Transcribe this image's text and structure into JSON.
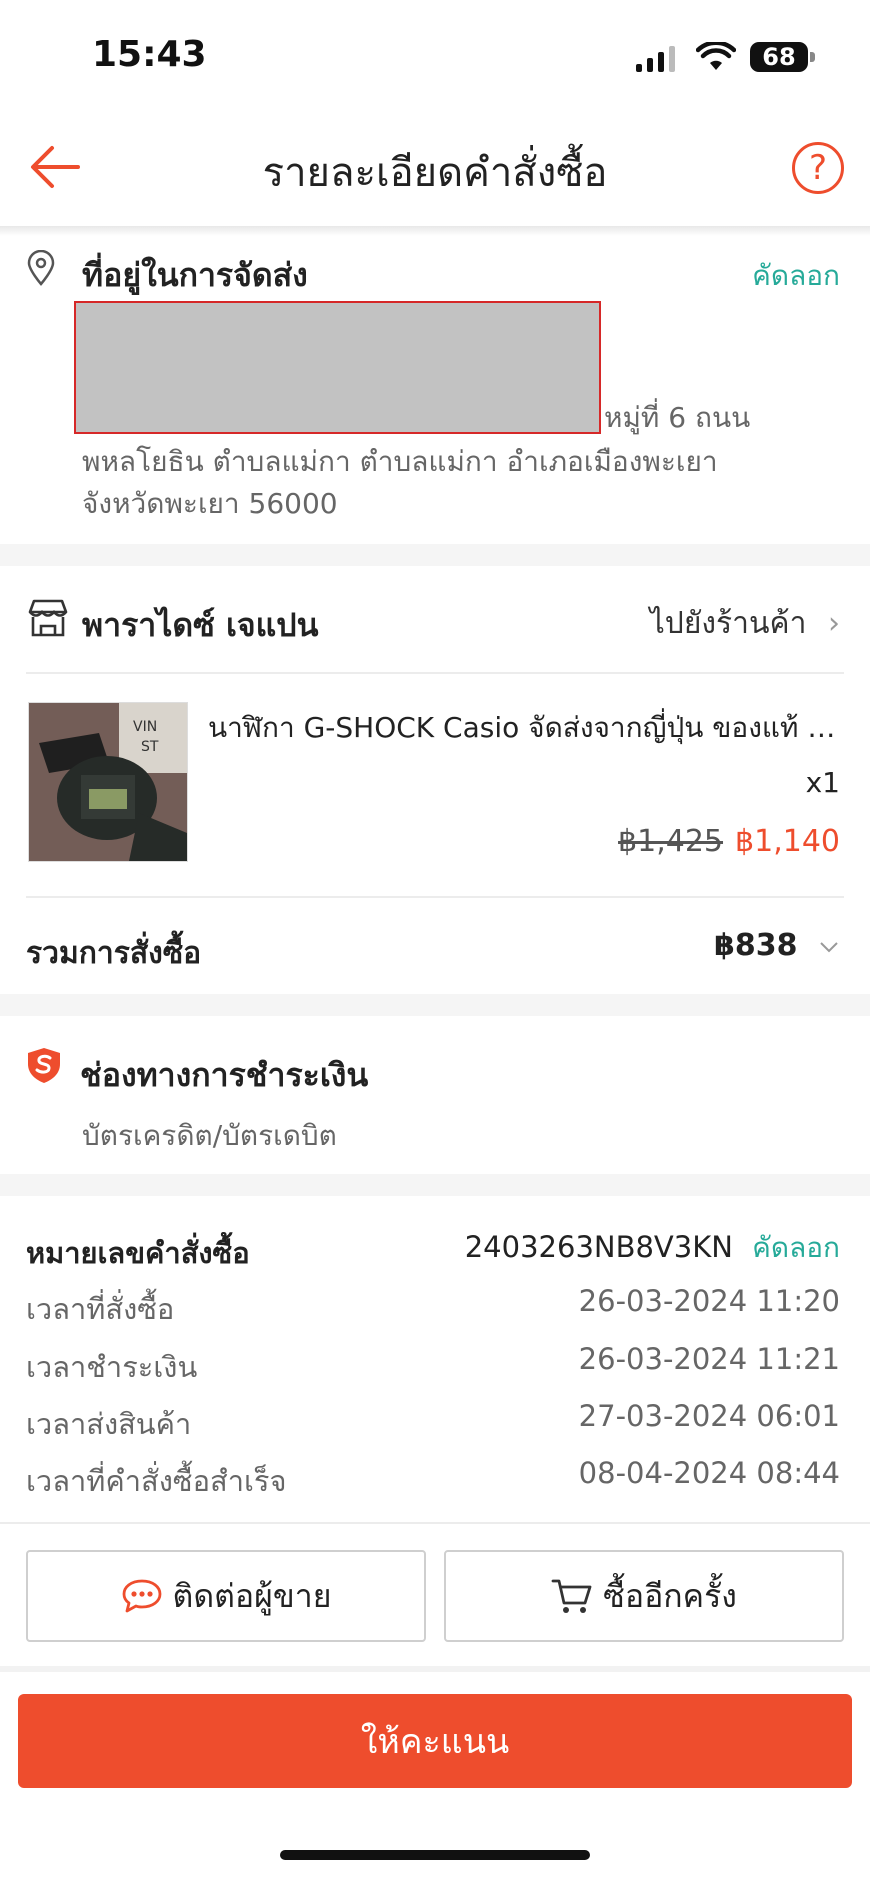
{
  "status_bar": {
    "time": "15:43",
    "battery": "68"
  },
  "header": {
    "title": "รายละเอียดคำสั่งซื้อ",
    "help": "?"
  },
  "address": {
    "title": "ที่อยู่ในการจัดส่ง",
    "copy_label": "คัดลอก",
    "line1_visible": "หมู่ที่ 6 ถนน",
    "line2": "พหลโยธิน ตำบลแม่กา ตำบลแม่กา อำเภอเมืองพะเยา",
    "line3": "จังหวัดพะเยา 56000"
  },
  "shop": {
    "name": "พาราไดซ์ เจแปน",
    "goto_label": "ไปยังร้านค้า"
  },
  "product": {
    "name": "นาฬิกา G-SHOCK Casio จัดส่งจากญี่ปุ่น ของแท้ มือสอง",
    "quantity": "x1",
    "original_price": "฿1,425",
    "price": "฿1,140"
  },
  "order_total": {
    "label": "รวมการสั่งซื้อ",
    "value": "฿838"
  },
  "payment": {
    "title": "ช่องทางการชำระเงิน",
    "method": "บัตรเครดิต/บัตรเดบิต"
  },
  "order_info": {
    "order_number_label": "หมายเลขคำสั่งซื้อ",
    "order_number": "2403263NB8V3KN",
    "copy_label": "คัดลอก",
    "rows": [
      {
        "label": "เวลาที่สั่งซื้อ",
        "value": "26-03-2024 11:20"
      },
      {
        "label": "เวลาชำระเงิน",
        "value": "26-03-2024 11:21"
      },
      {
        "label": "เวลาส่งสินค้า",
        "value": "27-03-2024 06:01"
      },
      {
        "label": "เวลาที่คำสั่งซื้อสำเร็จ",
        "value": "08-04-2024 08:44"
      }
    ]
  },
  "actions": {
    "contact_seller": "ติดต่อผู้ขาย",
    "buy_again": "ซื้ออีกครั้ง",
    "rate": "ให้คะแนน"
  },
  "colors": {
    "accent": "#ee4d2d",
    "copy": "#26aa99"
  }
}
